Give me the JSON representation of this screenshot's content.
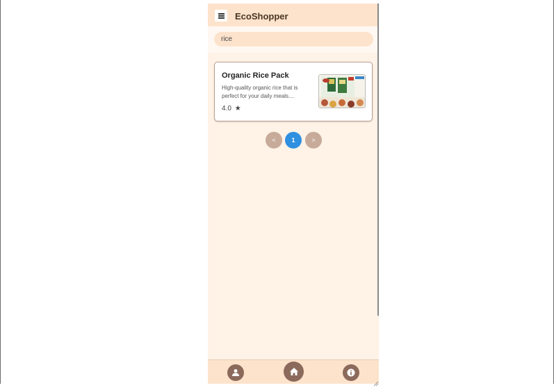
{
  "header": {
    "title": "EcoShopper"
  },
  "search": {
    "value": "rice"
  },
  "products": [
    {
      "name": "Organic Rice Pack",
      "description": "High-quality organic rice that is perfect for your daily meals....",
      "rating": "4.0",
      "star": "★"
    }
  ],
  "pagination": {
    "prev": "<",
    "current": "1",
    "next": ">"
  },
  "colors": {
    "accent": "#2f8fe0",
    "header_bg": "#fde3cc",
    "nav_button": "#8b6a5c"
  },
  "bottom_nav": {
    "items": [
      "profile-icon",
      "home-icon",
      "info-icon"
    ]
  }
}
